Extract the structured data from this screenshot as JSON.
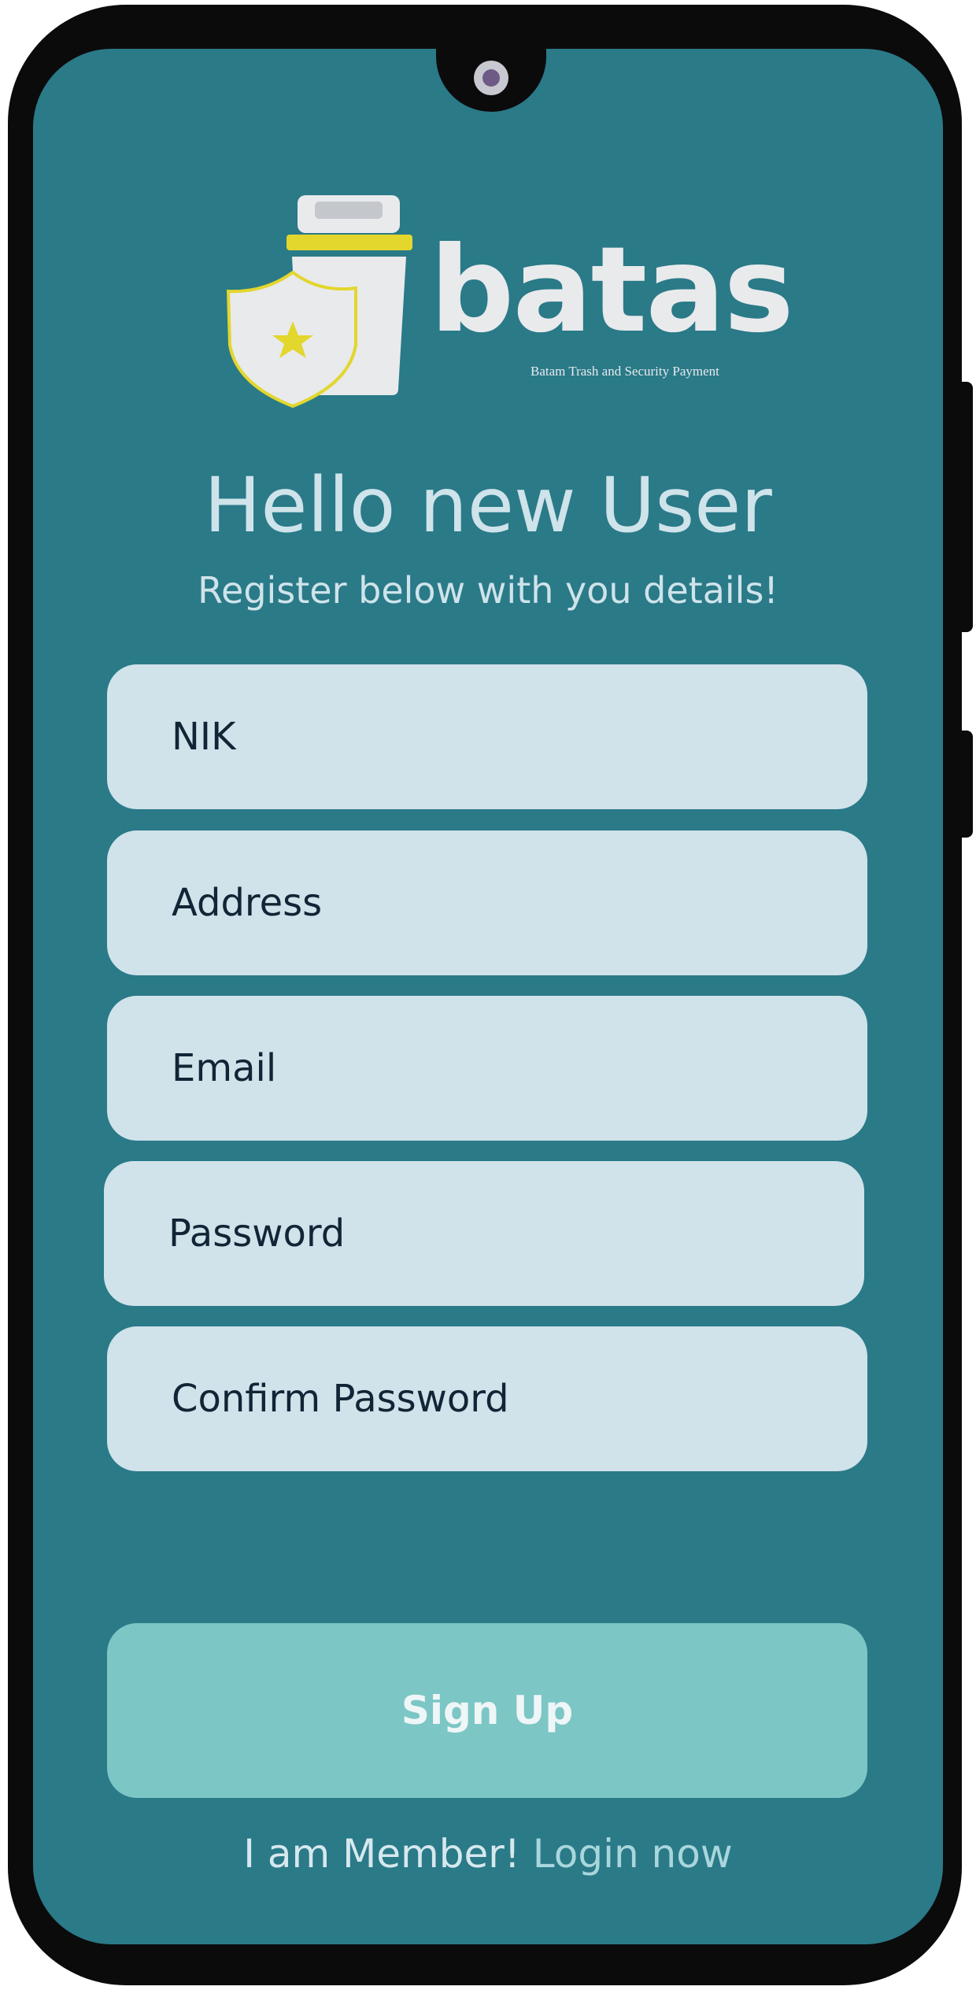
{
  "brand": {
    "name": "batas",
    "tagline": "Batam Trash and Security Payment"
  },
  "header": {
    "title": "Hello new User",
    "subtitle": "Register below with you details!"
  },
  "form": {
    "nik": {
      "placeholder": "NIK"
    },
    "address": {
      "placeholder": "Address"
    },
    "email": {
      "placeholder": "Email"
    },
    "password": {
      "placeholder": "Password"
    },
    "confirm_password": {
      "placeholder": "Confirm Password"
    },
    "submit_label": "Sign Up"
  },
  "footer": {
    "member_text": "I am Member!",
    "login_link": "Login now"
  },
  "icons": {
    "logo_bin": "trash-bin-icon",
    "logo_badge": "security-badge-icon"
  },
  "colors": {
    "screen_background": "#2a7a88",
    "field_background": "#d0e2ea",
    "button_background": "#7cc6c5",
    "logo_yellow": "#e3d62d",
    "text_light": "#cfe3ea"
  }
}
